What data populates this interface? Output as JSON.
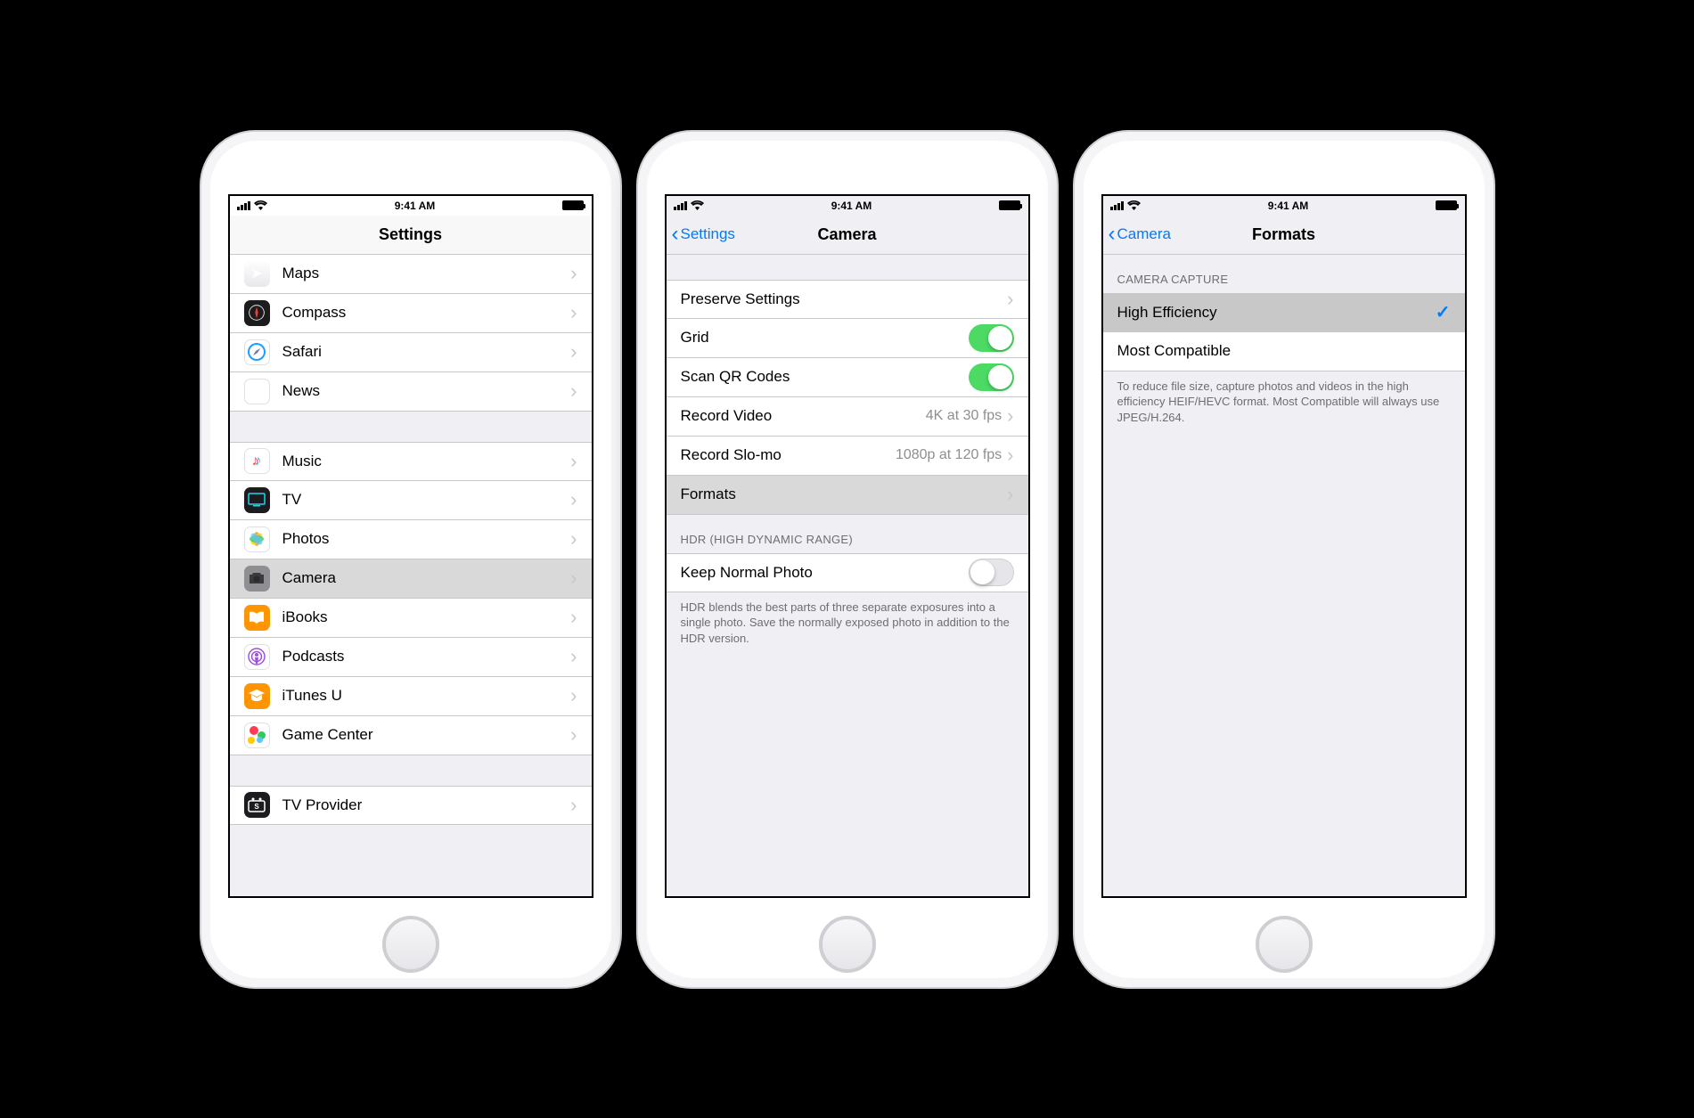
{
  "status": {
    "time": "9:41 AM"
  },
  "phone1": {
    "title": "Settings",
    "group1": [
      {
        "label": "Maps",
        "icon": "maps"
      },
      {
        "label": "Compass",
        "icon": "compass"
      },
      {
        "label": "Safari",
        "icon": "safari"
      },
      {
        "label": "News",
        "icon": "news"
      }
    ],
    "group2": [
      {
        "label": "Music",
        "icon": "music"
      },
      {
        "label": "TV",
        "icon": "tv"
      },
      {
        "label": "Photos",
        "icon": "photos"
      },
      {
        "label": "Camera",
        "icon": "camera",
        "selected": true
      },
      {
        "label": "iBooks",
        "icon": "ibooks"
      },
      {
        "label": "Podcasts",
        "icon": "podcasts"
      },
      {
        "label": "iTunes U",
        "icon": "itunesu"
      },
      {
        "label": "Game Center",
        "icon": "gamecenter"
      }
    ],
    "group3": [
      {
        "label": "TV Provider",
        "icon": "tvprov"
      }
    ]
  },
  "phone2": {
    "back": "Settings",
    "title": "Camera",
    "rows": {
      "preserve": "Preserve Settings",
      "grid": "Grid",
      "scanqr": "Scan QR Codes",
      "recordVideo": {
        "label": "Record Video",
        "detail": "4K at 30 fps"
      },
      "recordSlomo": {
        "label": "Record Slo-mo",
        "detail": "1080p at 120 fps"
      },
      "formats": "Formats"
    },
    "hdrHeader": "HDR (HIGH DYNAMIC RANGE)",
    "keepNormal": "Keep Normal Photo",
    "hdrFooter": "HDR blends the best parts of three separate exposures into a single photo. Save the normally exposed photo in addition to the HDR version."
  },
  "phone3": {
    "back": "Camera",
    "title": "Formats",
    "header": "CAMERA CAPTURE",
    "options": {
      "highEfficiency": "High Efficiency",
      "mostCompatible": "Most Compatible"
    },
    "footer": "To reduce file size, capture photos and videos in the high efficiency HEIF/HEVC format. Most Compatible will always use JPEG/H.264."
  }
}
